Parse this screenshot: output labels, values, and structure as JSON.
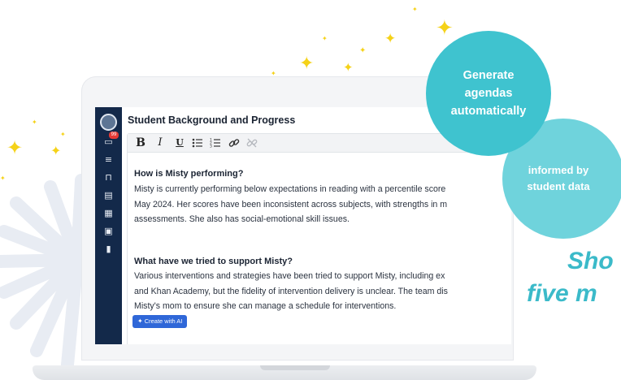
{
  "bubbles": {
    "primary_lines": [
      "Generate",
      "agendas",
      "automatically"
    ],
    "secondary_lines": [
      "informed by",
      "student data"
    ]
  },
  "headline_lines": [
    "Sho",
    "five m"
  ],
  "editor": {
    "section_title": "Student Background and Progress",
    "toolbar": {
      "bold": "B",
      "italic": "I",
      "underline": "U",
      "bullet_list_icon": "bullet-list-icon",
      "numbered_list_icon": "numbered-list-icon",
      "link_icon": "link-icon",
      "unlink_icon": "unlink-icon"
    },
    "blocks": [
      {
        "question": "How is Misty performing?",
        "lines": [
          "Misty is currently performing below expectations in reading with a percentile score",
          "May 2024. Her scores have been inconsistent across subjects, with strengths in m",
          "assessments. She also has social-emotional skill issues."
        ]
      },
      {
        "question": "What have we tried to support Misty?",
        "lines": [
          "Various interventions and strategies have been tried to support Misty, including ex",
          "and Khan Academy, but the fidelity of intervention delivery is unclear. The team dis",
          "Misty's mom to ensure she can manage a schedule for interventions."
        ]
      }
    ],
    "ai_button_label": "Create with AI"
  },
  "sidebar": {
    "badge_count": "99",
    "icons": [
      "app-logo-icon",
      "inbox-icon",
      "school-icon",
      "classroom-icon",
      "document-icon",
      "map-icon",
      "calendar-icon",
      "chart-icon"
    ]
  },
  "colors": {
    "teal": "#3fc3cf",
    "teal_light": "#6fd3dc",
    "sidebar_navy": "#13294a",
    "ai_button_blue": "#2f67d8",
    "sparkle_yellow": "#f5d218"
  }
}
